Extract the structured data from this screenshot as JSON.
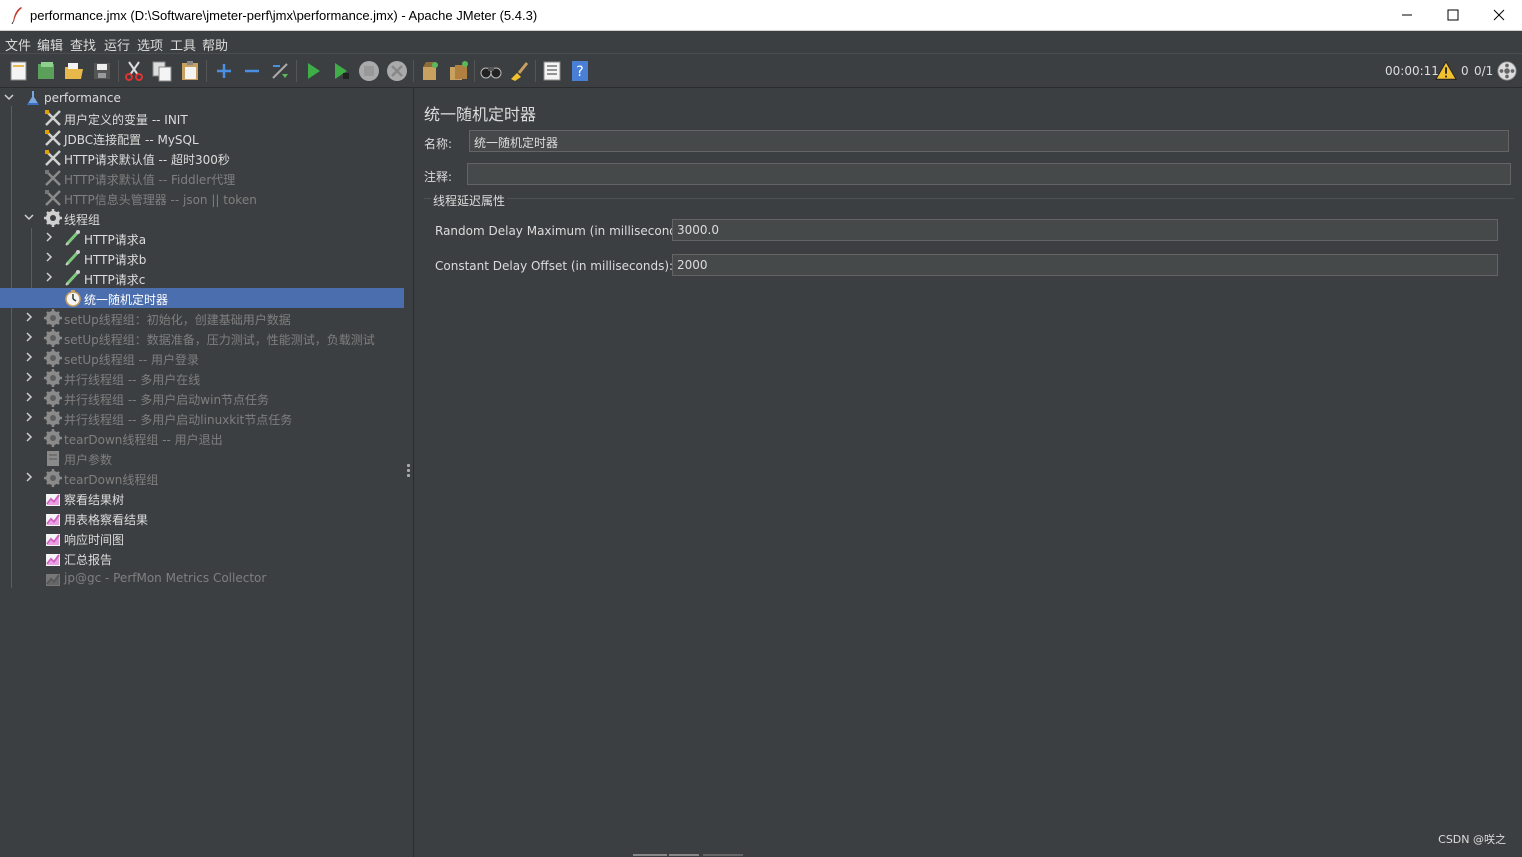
{
  "window": {
    "title": "performance.jmx (D:\\Software\\jmeter-perf\\jmx\\performance.jmx) - Apache JMeter (5.4.3)"
  },
  "menu": [
    "文件",
    "编辑",
    "查找",
    "运行",
    "选项",
    "工具",
    "帮助"
  ],
  "toolbar": {
    "icons": [
      "new-icon",
      "templates-icon",
      "open-icon",
      "save-icon",
      "cut-icon",
      "copy-icon",
      "paste-icon",
      "expand-icon",
      "collapse-icon",
      "toggle-icon",
      "start-icon",
      "start-no-pause-icon",
      "stop-icon",
      "shutdown-icon",
      "clear-icon",
      "clear-all-icon",
      "search-icon",
      "reset-search-icon",
      "function-helper-icon",
      "help-icon"
    ],
    "elapsed": "00:00:11",
    "warnings": "0",
    "threads": "0/1"
  },
  "tree": [
    {
      "label": "performance",
      "enabled": true,
      "icon": "testplan-icon",
      "level": 0,
      "arrow": "down"
    },
    {
      "label": "用户定义的变量 -- INIT",
      "enabled": true,
      "icon": "config-icon",
      "level": 1
    },
    {
      "label": "JDBC连接配置 -- MySQL",
      "enabled": true,
      "icon": "config-icon",
      "level": 1
    },
    {
      "label": "HTTP请求默认值 -- 超时300秒",
      "enabled": true,
      "icon": "config-icon",
      "level": 1
    },
    {
      "label": "HTTP请求默认值 -- Fiddler代理",
      "enabled": false,
      "icon": "config-icon",
      "level": 1
    },
    {
      "label": "HTTP信息头管理器 -- json || token",
      "enabled": false,
      "icon": "config-icon",
      "level": 1
    },
    {
      "label": "线程组",
      "enabled": true,
      "icon": "threadgroup-icon",
      "level": 1,
      "arrow": "down"
    },
    {
      "label": "HTTP请求a",
      "enabled": true,
      "icon": "sampler-icon",
      "level": 2,
      "arrow": "right"
    },
    {
      "label": "HTTP请求b",
      "enabled": true,
      "icon": "sampler-icon",
      "level": 2,
      "arrow": "right"
    },
    {
      "label": "HTTP请求c",
      "enabled": true,
      "icon": "sampler-icon",
      "level": 2,
      "arrow": "right"
    },
    {
      "label": "统一随机定时器",
      "enabled": true,
      "icon": "timer-icon",
      "level": 2,
      "selected": true
    },
    {
      "label": "setUp线程组：初始化，创建基础用户数据",
      "enabled": false,
      "icon": "threadgroup-icon",
      "level": 1,
      "arrow": "right"
    },
    {
      "label": "setUp线程组：数据准备，压力测试，性能测试，负载测试",
      "enabled": false,
      "icon": "threadgroup-icon",
      "level": 1,
      "arrow": "right"
    },
    {
      "label": "setUp线程组 -- 用户登录",
      "enabled": false,
      "icon": "threadgroup-icon",
      "level": 1,
      "arrow": "right"
    },
    {
      "label": "并行线程组 -- 多用户在线",
      "enabled": false,
      "icon": "threadgroup-icon",
      "level": 1,
      "arrow": "right"
    },
    {
      "label": "并行线程组 -- 多用户启动win节点任务",
      "enabled": false,
      "icon": "threadgroup-icon",
      "level": 1,
      "arrow": "right"
    },
    {
      "label": "并行线程组 -- 多用户启动linuxkit节点任务",
      "enabled": false,
      "icon": "threadgroup-icon",
      "level": 1,
      "arrow": "right"
    },
    {
      "label": "tearDown线程组 -- 用户退出",
      "enabled": false,
      "icon": "threadgroup-icon",
      "level": 1,
      "arrow": "right"
    },
    {
      "label": "用户参数",
      "enabled": false,
      "icon": "preprocessor-icon",
      "level": 1
    },
    {
      "label": "tearDown线程组",
      "enabled": false,
      "icon": "threadgroup-icon",
      "level": 1,
      "arrow": "right"
    },
    {
      "label": "察看结果树",
      "enabled": true,
      "icon": "listener-icon",
      "level": 1
    },
    {
      "label": "用表格察看结果",
      "enabled": true,
      "icon": "listener-icon",
      "level": 1
    },
    {
      "label": "响应时间图",
      "enabled": true,
      "icon": "listener-icon",
      "level": 1
    },
    {
      "label": "汇总报告",
      "enabled": true,
      "icon": "listener-icon",
      "level": 1
    },
    {
      "label": "jp@gc - PerfMon Metrics Collector",
      "enabled": false,
      "icon": "listener-icon",
      "level": 1
    }
  ],
  "panel": {
    "title": "统一随机定时器",
    "name_label": "名称:",
    "name_value": "统一随机定时器",
    "comment_label": "注释:",
    "comment_value": "",
    "group_title": "线程延迟属性",
    "random_delay_label": "Random Delay Maximum (in milliseconds):",
    "random_delay_value": "3000.0",
    "constant_delay_label": "Constant Delay Offset (in milliseconds):",
    "constant_delay_value": "2000"
  },
  "watermark": "CSDN @咲之"
}
